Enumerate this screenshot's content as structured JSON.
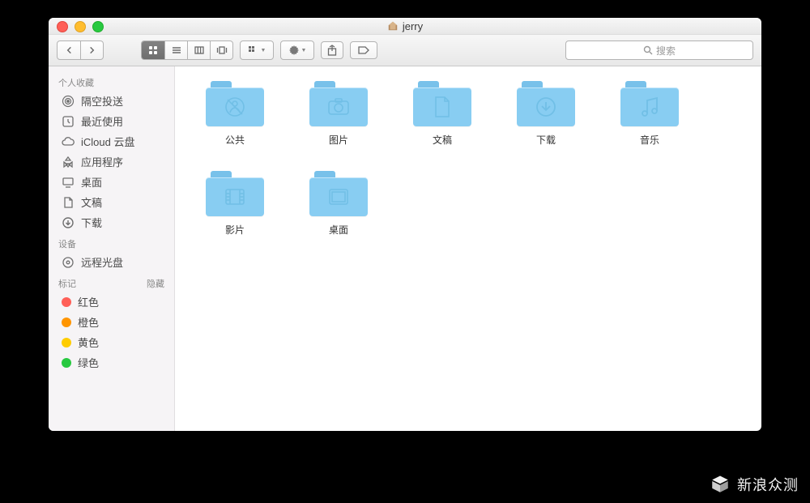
{
  "window": {
    "title": "jerry"
  },
  "search": {
    "placeholder": "搜索"
  },
  "sidebar": {
    "sections": [
      {
        "title": "个人收藏",
        "hide_label": "",
        "items": [
          {
            "icon": "airdrop-icon",
            "label": "隔空投送"
          },
          {
            "icon": "clock-icon",
            "label": "最近使用"
          },
          {
            "icon": "icloud-icon",
            "label": "iCloud 云盘"
          },
          {
            "icon": "apps-icon",
            "label": "应用程序"
          },
          {
            "icon": "desktop-icon",
            "label": "桌面"
          },
          {
            "icon": "documents-icon",
            "label": "文稿"
          },
          {
            "icon": "downloads-icon",
            "label": "下载"
          }
        ]
      },
      {
        "title": "设备",
        "hide_label": "",
        "items": [
          {
            "icon": "disc-icon",
            "label": "远程光盘"
          }
        ]
      },
      {
        "title": "标记",
        "hide_label": "隐藏",
        "items": [
          {
            "color": "#ff5f57",
            "label": "红色"
          },
          {
            "color": "#ff9500",
            "label": "橙色"
          },
          {
            "color": "#ffcc00",
            "label": "黄色"
          },
          {
            "color": "#28c940",
            "label": "绿色"
          }
        ]
      }
    ]
  },
  "folders": [
    {
      "label": "公共",
      "glyph": "public-glyph"
    },
    {
      "label": "图片",
      "glyph": "pictures-glyph"
    },
    {
      "label": "文稿",
      "glyph": "documents-glyph"
    },
    {
      "label": "下载",
      "glyph": "downloads-glyph"
    },
    {
      "label": "音乐",
      "glyph": "music-glyph"
    },
    {
      "label": "影片",
      "glyph": "movies-glyph"
    },
    {
      "label": "桌面",
      "glyph": "desktop-glyph"
    }
  ],
  "watermark": "新浪众测"
}
